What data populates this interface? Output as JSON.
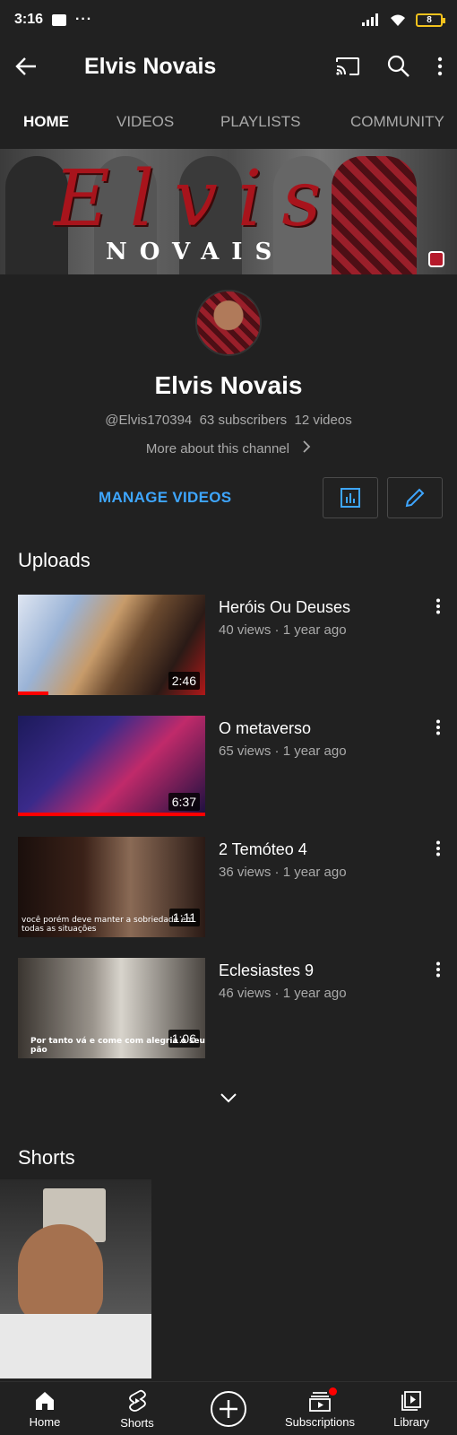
{
  "status_bar": {
    "time": "3:16",
    "dots": "···",
    "battery": "8"
  },
  "app_bar": {
    "title": "Elvis Novais"
  },
  "tabs": [
    {
      "label": "HOME"
    },
    {
      "label": "VIDEOS"
    },
    {
      "label": "PLAYLISTS"
    },
    {
      "label": "COMMUNITY"
    }
  ],
  "banner": {
    "title": "Elvis",
    "subtitle": "NOVAIS"
  },
  "channel": {
    "name": "Elvis Novais",
    "handle": "@Elvis170394",
    "subscribers": "63 subscribers",
    "videos": "12 videos",
    "more_about": "More about this channel"
  },
  "actions": {
    "manage_videos": "MANAGE VIDEOS"
  },
  "uploads": {
    "title": "Uploads",
    "videos": [
      {
        "title": "Heróis Ou Deuses",
        "views": "40 views",
        "age": "1 year ago",
        "duration": "2:46",
        "watched": 0.16
      },
      {
        "title": "O metaverso",
        "views": "65 views",
        "age": "1 year ago",
        "duration": "6:37",
        "watched": 1.0
      },
      {
        "title": "2 Temóteo 4",
        "views": "36 views",
        "age": "1 year ago",
        "duration": "1:11",
        "caption": "você porém deve manter a sobriedade em todas as situações"
      },
      {
        "title": "Eclesiastes 9",
        "views": "46 views",
        "age": "1 year ago",
        "duration": "1:06",
        "caption": "Por tanto vá e come com alegria o seu pão"
      }
    ]
  },
  "shorts": {
    "title": "Shorts"
  },
  "bottom_nav": [
    {
      "label": "Home"
    },
    {
      "label": "Shorts"
    },
    {
      "label": ""
    },
    {
      "label": "Subscriptions"
    },
    {
      "label": "Library"
    }
  ],
  "colors": {
    "background": "#212121",
    "accent": "#3ea6ff",
    "progress": "#ff0000",
    "banner_red": "#a8141c"
  }
}
